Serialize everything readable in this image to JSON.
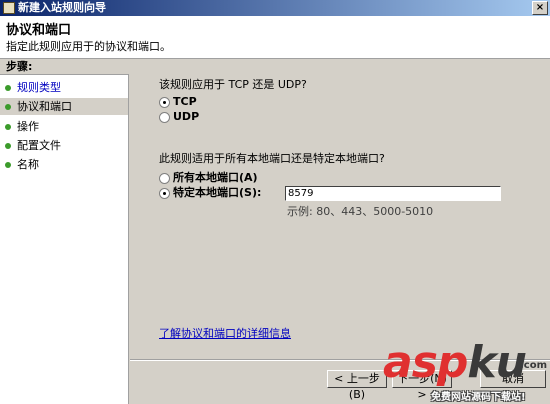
{
  "window": {
    "title": "新建入站规则向导"
  },
  "header": {
    "title": "协议和端口",
    "description": "指定此规则应用于的协议和端口。"
  },
  "sidebar": {
    "header": "步骤:",
    "items": [
      {
        "label": "规则类型",
        "state": "completed-link"
      },
      {
        "label": "协议和端口",
        "state": "active"
      },
      {
        "label": "操作",
        "state": "pending"
      },
      {
        "label": "配置文件",
        "state": "pending"
      },
      {
        "label": "名称",
        "state": "pending"
      }
    ]
  },
  "protocol": {
    "question": "该规则应用于 TCP 还是 UDP?",
    "options": [
      {
        "label": "TCP",
        "checked": true
      },
      {
        "label": "UDP",
        "checked": false
      }
    ]
  },
  "ports": {
    "question": "此规则适用于所有本地端口还是特定本地端口?",
    "options": [
      {
        "label": "所有本地端口(A)",
        "checked": false
      },
      {
        "label": "特定本地端口(S):",
        "checked": true
      }
    ],
    "value": "8579",
    "example": "示例: 80、443、5000-5010"
  },
  "learn_more": "了解协议和端口的详细信息",
  "buttons": {
    "back": "< 上一步(B)",
    "next": "下一步(N) >",
    "cancel": "取消"
  },
  "watermark": {
    "logo_a": "asp",
    "logo_b": "ku",
    "logo_suffix": ".com",
    "tagline": "免费网站源码下载站!"
  },
  "colors": {
    "title_bar": "#0a246a",
    "link": "#0000c0",
    "step_dot": "#3b9b2b",
    "watermark_red": "#e03030"
  }
}
